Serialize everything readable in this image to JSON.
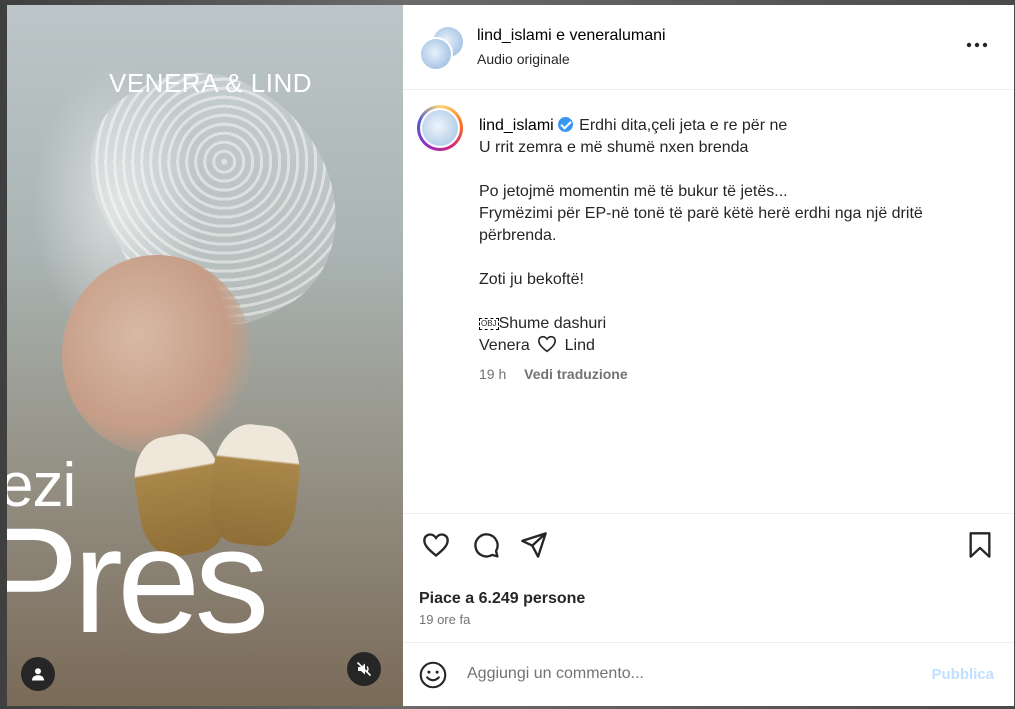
{
  "media": {
    "title_text": "VENERA & LIND",
    "overlay_line1": "ezi",
    "overlay_line2": "Pres"
  },
  "header": {
    "authors": "lind_islami e veneralumani",
    "audio": "Audio originale"
  },
  "caption": {
    "username": "lind_islami",
    "line1": "Erdhi dita,çeli jeta e re për ne",
    "line2": "U rrit zemra e më shumë nxen brenda",
    "line3": "Po jetojmë momentin më të bukur të jetës...",
    "line4": "Frymëzimi për EP-në tonë të parë këtë herë erdhi nga një dritë përbrenda.",
    "line5": "Zoti ju bekoftë!",
    "obj_glyph": "OBJ",
    "line6": "Shume dashuri",
    "sig_left": "Venera",
    "sig_right": "Lind",
    "time_ago": "19 h",
    "translate": "Vedi traduzione"
  },
  "actions": {
    "icons": [
      "heart-icon",
      "comment-icon",
      "share-icon",
      "bookmark-icon"
    ]
  },
  "likes": {
    "count_text": "Piace a 6.249 persone",
    "time_text": "19 ore fa"
  },
  "comment": {
    "placeholder": "Aggiungi un commento...",
    "post_label": "Pubblica"
  },
  "colors": {
    "verified": "#3897f0",
    "post_disabled": "#c0dffd",
    "muted_text": "#737373"
  }
}
